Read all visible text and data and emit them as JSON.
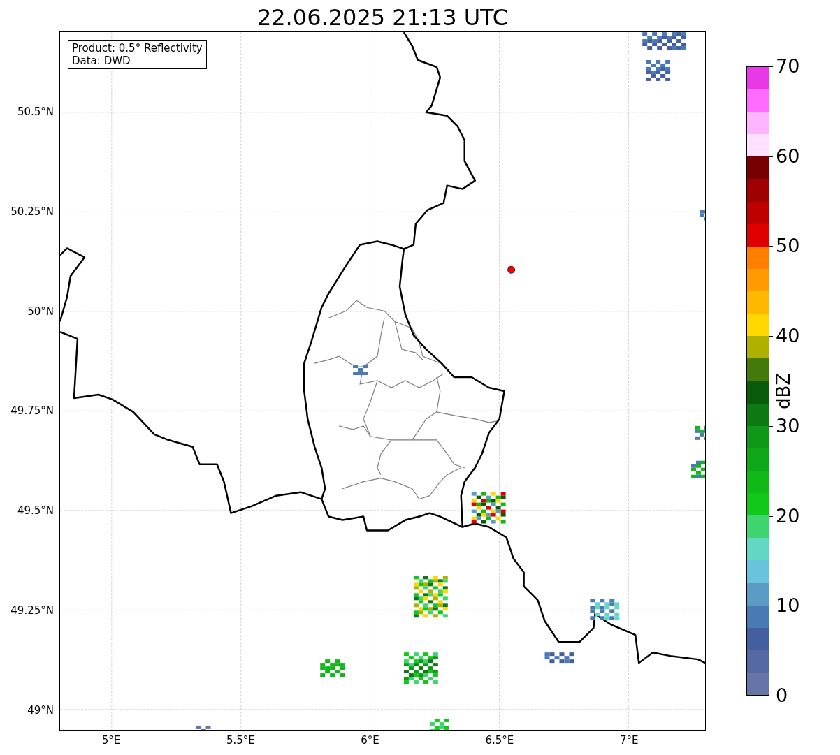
{
  "title": "22.06.2025 21:13 UTC",
  "legend": [
    "Product: 0.5° Reflectivity",
    "Data: DWD"
  ],
  "map": {
    "lat_labels": [
      "50.5°N",
      "50.25°N",
      "50°N",
      "49.75°N",
      "49.5°N",
      "49.25°N",
      "49°N"
    ],
    "lon_labels": [
      "5°E",
      "5.5°E",
      "6°E",
      "6.5°E",
      "7°E"
    ]
  },
  "colorbar": {
    "label": "dBZ",
    "ticks": [
      "70",
      "60",
      "50",
      "40",
      "30",
      "20",
      "10",
      "0"
    ],
    "segments": [
      {
        "color": "#e838e8"
      },
      {
        "color": "#ff6cff"
      },
      {
        "color": "#ffb4ff"
      },
      {
        "color": "#ffe0ff"
      },
      {
        "color": "#780000"
      },
      {
        "color": "#a00000"
      },
      {
        "color": "#c00000"
      },
      {
        "color": "#e00000"
      },
      {
        "color": "#ff7f00"
      },
      {
        "color": "#ff9a00"
      },
      {
        "color": "#ffb800"
      },
      {
        "color": "#ffd800"
      },
      {
        "color": "#b0b000"
      },
      {
        "color": "#447a0a"
      },
      {
        "color": "#085c0a"
      },
      {
        "color": "#0c7a12"
      },
      {
        "color": "#0f9818"
      },
      {
        "color": "#10a818"
      },
      {
        "color": "#10b818"
      },
      {
        "color": "#10c818"
      },
      {
        "color": "#3ed46e"
      },
      {
        "color": "#62d8c4"
      },
      {
        "color": "#68c3dc"
      },
      {
        "color": "#5a9cc6"
      },
      {
        "color": "#4a7ab3"
      },
      {
        "color": "#445fa0"
      },
      {
        "color": "#5468a4"
      },
      {
        "color": "#6674a8"
      }
    ]
  }
}
